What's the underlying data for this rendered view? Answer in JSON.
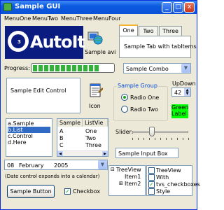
{
  "window": {
    "title": "Sample GUI",
    "min_symbol": "_",
    "max_symbol": "□",
    "close_symbol": "x"
  },
  "menu": [
    "MenuOne",
    "MenuTwo",
    "MenuThree",
    "MenuFour"
  ],
  "logo": {
    "text": "AutoIt",
    "version": "3"
  },
  "avi": {
    "label": "Sample avi"
  },
  "tabs": {
    "items": [
      "One",
      "Two",
      "Three"
    ],
    "active": "One",
    "content": "Sample Tab with tabItems"
  },
  "progress": {
    "label": "Progress:",
    "value": 0.85
  },
  "combo": {
    "value": "Sample Combo"
  },
  "edit": {
    "text": "Sample Edit Control"
  },
  "icon": {
    "label": "Icon"
  },
  "group": {
    "title": "Sample Group",
    "radio1": "Radio One",
    "radio2": "Radio Two",
    "selected": "Radio One"
  },
  "updown": {
    "label": "UpDown",
    "value": "42"
  },
  "green_label": {
    "text": "Green Label"
  },
  "listbox": {
    "items": [
      "a.Sample",
      "b.List",
      "c.Control",
      "d.Here"
    ],
    "selected": "b.List"
  },
  "listview": {
    "headers": [
      "Sample",
      "ListVie"
    ],
    "rows": [
      [
        "A",
        "One"
      ],
      [
        "B",
        "Two"
      ],
      [
        "C",
        "Three"
      ]
    ]
  },
  "slider": {
    "label": "Slider:",
    "value": 0.35
  },
  "input": {
    "value": "Sample Input Box"
  },
  "date": {
    "day": "08",
    "month": "February",
    "year": "2005",
    "hint": "(Date control expands into a calendar)"
  },
  "treeview1": {
    "root": "TreeView",
    "children": [
      "Item1",
      "Item2"
    ]
  },
  "treeview2": {
    "items": [
      {
        "label": "TreeView",
        "checked": false
      },
      {
        "label": "With",
        "checked": false
      },
      {
        "label": "tvs_checkboxes",
        "checked": true
      },
      {
        "label": "Style",
        "checked": false
      }
    ]
  },
  "button": {
    "label": "Sample Button"
  },
  "checkbox": {
    "label": "Checkbox",
    "checked": true
  }
}
